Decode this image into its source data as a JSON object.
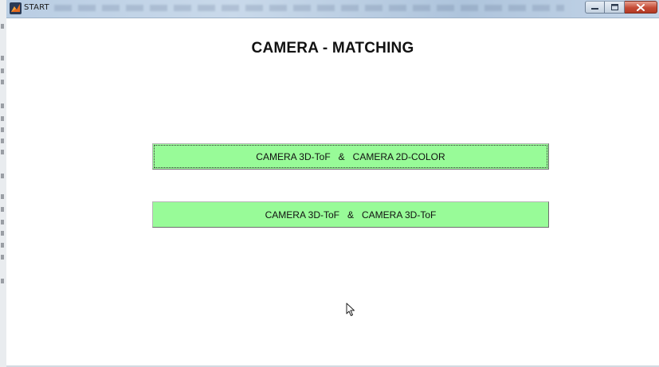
{
  "window": {
    "title": "START"
  },
  "main": {
    "heading": "CAMERA - MATCHING",
    "buttons": [
      {
        "label": "CAMERA 3D-ToF   &   CAMERA 2D-COLOR",
        "focused": true
      },
      {
        "label": "CAMERA 3D-ToF   &   CAMERA 3D-ToF",
        "focused": false
      }
    ]
  },
  "colors": {
    "button_background": "#98fb98",
    "close_button": "#c54c36",
    "titlebar": "#b9cde3"
  },
  "icons": {
    "app": "matlab-icon",
    "minimize": "minimize-icon",
    "maximize": "maximize-icon",
    "close": "close-icon",
    "pointer": "mouse-cursor-icon"
  }
}
